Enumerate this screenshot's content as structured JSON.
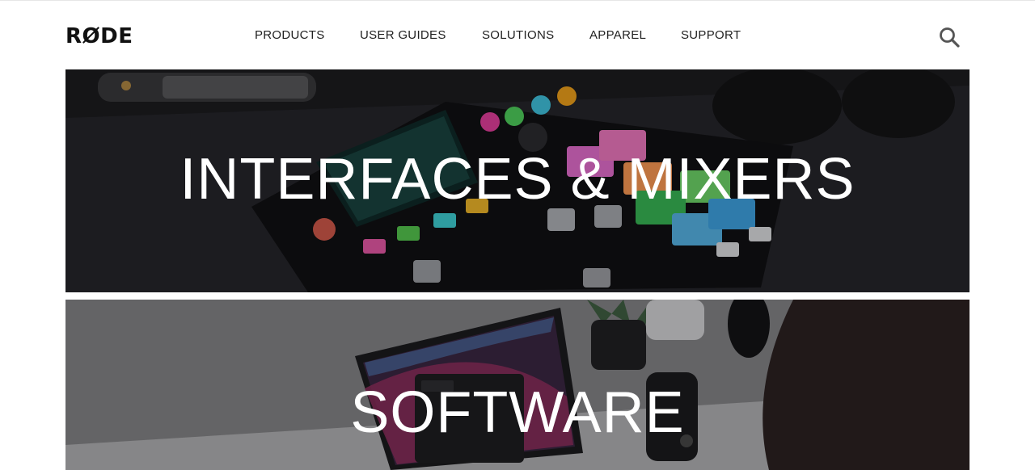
{
  "header": {
    "logo_text": "RØDE",
    "nav": [
      {
        "label": "PRODUCTS"
      },
      {
        "label": "USER GUIDES"
      },
      {
        "label": "SOLUTIONS"
      },
      {
        "label": "APPAREL"
      },
      {
        "label": "SUPPORT"
      }
    ],
    "search_icon": "search-icon"
  },
  "tiles": [
    {
      "label": "INTERFACES & MIXERS",
      "image": "rodecaster-pro-mixer-photo"
    },
    {
      "label": "SOFTWARE",
      "image": "laptop-and-microphone-photo"
    }
  ],
  "colors": {
    "text": "#222222",
    "tile_text": "#ffffff"
  }
}
